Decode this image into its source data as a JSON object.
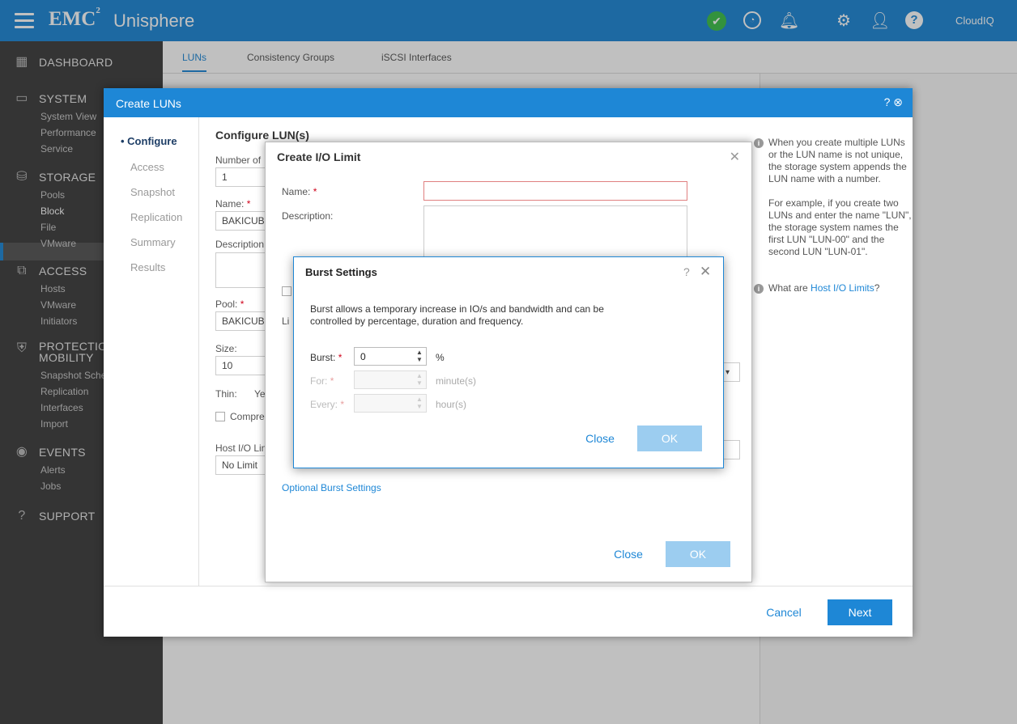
{
  "header": {
    "brand": "EMC",
    "brand_sup": "2",
    "product": "Unisphere",
    "cloudiq": "CloudIQ"
  },
  "sidebar": {
    "sections": [
      {
        "label": "DASHBOARD",
        "icon": "dashboard-icon"
      },
      {
        "label": "SYSTEM",
        "icon": "system-icon",
        "items": [
          "System View",
          "Performance",
          "Service"
        ]
      },
      {
        "label": "STORAGE",
        "icon": "storage-icon",
        "items": [
          "Pools",
          "Block",
          "File",
          "VMware"
        ]
      },
      {
        "label": "ACCESS",
        "icon": "access-icon",
        "items": [
          "Hosts",
          "VMware",
          "Initiators"
        ]
      },
      {
        "label": "PROTECTION &",
        "label2": "MOBILITY",
        "icon": "protection-icon",
        "items": [
          "Snapshot Schedule",
          "Replication",
          "Interfaces",
          "Import"
        ]
      },
      {
        "label": "EVENTS",
        "icon": "events-icon",
        "items": [
          "Alerts",
          "Jobs"
        ]
      },
      {
        "label": "SUPPORT",
        "icon": "support-icon"
      }
    ]
  },
  "tabs": [
    "LUNs",
    "Consistency Groups",
    "iSCSI Interfaces"
  ],
  "create_luns": {
    "title": "Create LUNs",
    "steps": [
      "Configure",
      "Access",
      "Snapshot",
      "Replication",
      "Summary",
      "Results"
    ],
    "heading": "Configure LUN(s)",
    "number_label": "Number of",
    "number_value": "1",
    "name_label": "Name:",
    "name_value": "BAKICUBUK",
    "description_label": "Description",
    "pool_label": "Pool:",
    "pool_value": "BAKICUBUK",
    "size_label": "Size:",
    "size_value": "10",
    "thin_label": "Thin:",
    "thin_value": "Ye",
    "compression_label": "Compre",
    "host_io_label": "Host I/O Lin",
    "host_io_value": "No Limit",
    "hint_p1": "When you create multiple LUNs or the LUN name is not unique, the storage system appends the LUN name with a number.",
    "hint_p2": "For example, if you create two LUNs and enter the name \"LUN\", the storage system names the first LUN \"LUN-00\" and the second LUN \"LUN-01\".",
    "hint_q": "What are",
    "hint_link": "Host I/O Limits",
    "hint_q_end": "?",
    "cancel": "Cancel",
    "next": "Next"
  },
  "io_limit": {
    "title": "Create I/O Limit",
    "name_label": "Name:",
    "description_label": "Description:",
    "limit_label": "Li",
    "burst_link": "Optional Burst Settings",
    "close": "Close",
    "ok": "OK"
  },
  "burst": {
    "title": "Burst Settings",
    "help": "?",
    "description": "Burst allows a temporary increase in IO/s and bandwidth and can be controlled by percentage, duration and frequency.",
    "burst_label": "Burst:",
    "burst_value": "0",
    "burst_unit": "%",
    "for_label": "For:",
    "for_unit": "minute(s)",
    "every_label": "Every:",
    "every_unit": "hour(s)",
    "close": "Close",
    "ok": "OK"
  }
}
